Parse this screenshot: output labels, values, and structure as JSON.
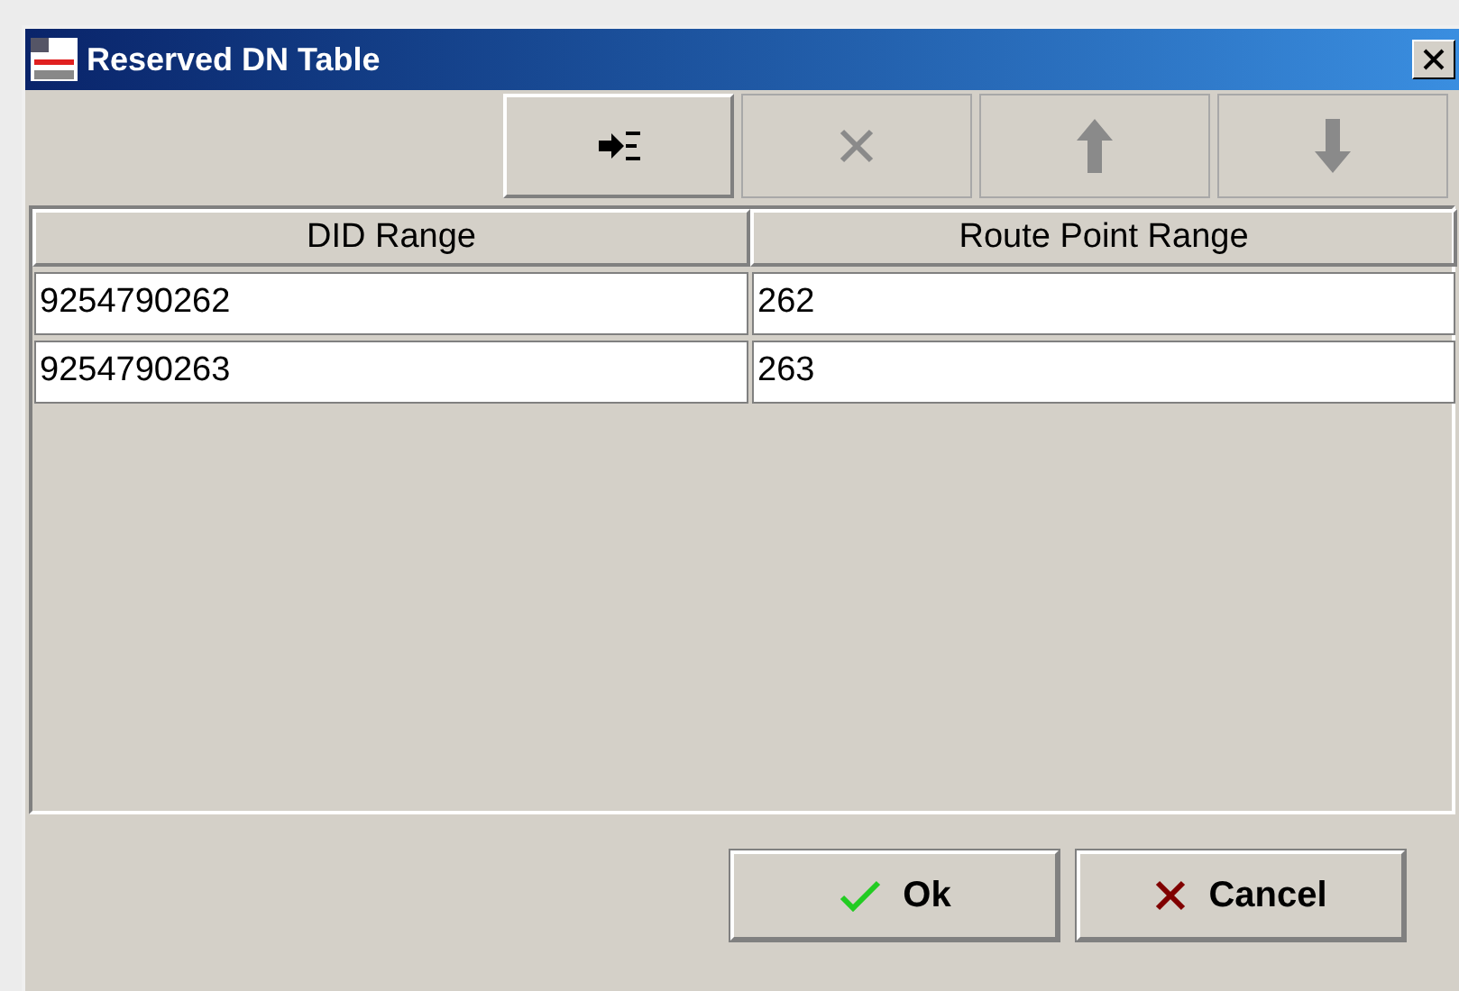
{
  "window": {
    "title": "Reserved DN Table"
  },
  "toolbar": [
    {
      "kind": "add",
      "disabled": false
    },
    {
      "kind": "delete",
      "disabled": true
    },
    {
      "kind": "up",
      "disabled": true
    },
    {
      "kind": "down",
      "disabled": true
    }
  ],
  "table": {
    "columns": [
      "DID Range",
      "Route Point Range"
    ],
    "rows": [
      [
        "9254790262",
        "262"
      ],
      [
        "9254790263",
        "263"
      ]
    ]
  },
  "buttons": [
    {
      "kind": "ok",
      "label": "Ok"
    },
    {
      "kind": "cancel",
      "label": "Cancel"
    }
  ]
}
